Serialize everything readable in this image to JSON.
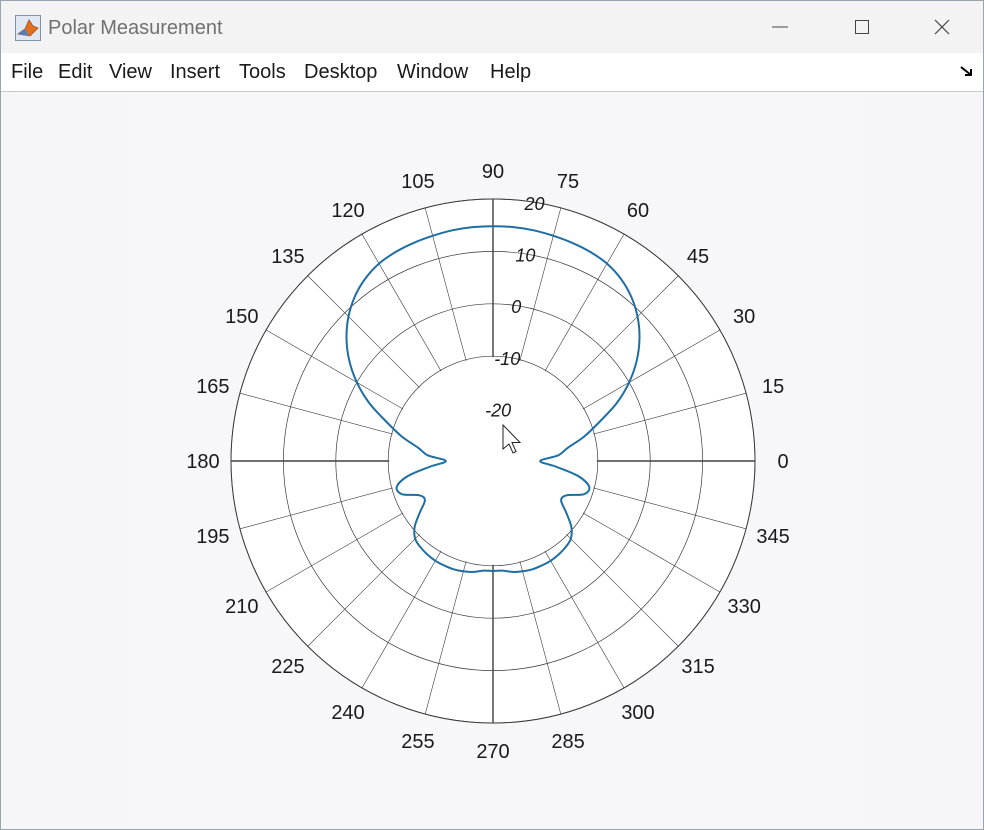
{
  "window": {
    "title": "Polar Measurement",
    "icon": "matlab-figure-icon"
  },
  "menu": [
    {
      "key": "file",
      "label": "File"
    },
    {
      "key": "edit",
      "label": "Edit"
    },
    {
      "key": "view",
      "label": "View"
    },
    {
      "key": "insert",
      "label": "Insert"
    },
    {
      "key": "tools",
      "label": "Tools"
    },
    {
      "key": "desktop",
      "label": "Desktop"
    },
    {
      "key": "window",
      "label": "Window"
    },
    {
      "key": "help",
      "label": "Help"
    }
  ],
  "colors": {
    "trace": "#1f6ea3",
    "grid": "#3a3a3a",
    "axis_bg": "#ffffff",
    "figure_bg": "#f6f6f8"
  },
  "chart_data": {
    "type": "polar",
    "angle_unit": "degrees",
    "angle_ticks": [
      0,
      15,
      30,
      45,
      60,
      75,
      90,
      105,
      120,
      135,
      150,
      165,
      180,
      195,
      210,
      225,
      240,
      255,
      270,
      285,
      300,
      315,
      330,
      345
    ],
    "radial_ticks": [
      -20,
      -10,
      0,
      10,
      20
    ],
    "radial_tick_labels": [
      "-20",
      "-10",
      "0",
      "10",
      "20"
    ],
    "rlim": [
      -30,
      20
    ],
    "grid": true,
    "series": [
      {
        "color": "#1f6ea3",
        "theta_deg": [
          0,
          5,
          10,
          15,
          20,
          25,
          30,
          35,
          40,
          45,
          50,
          55,
          60,
          65,
          70,
          75,
          80,
          85,
          90,
          95,
          100,
          105,
          110,
          115,
          120,
          125,
          130,
          135,
          140,
          145,
          150,
          155,
          160,
          165,
          170,
          175,
          180,
          185,
          190,
          195,
          200,
          205,
          210,
          215,
          220,
          225,
          230,
          235,
          240,
          245,
          250,
          255,
          260,
          265,
          270,
          275,
          280,
          285,
          290,
          295,
          300,
          305,
          310,
          315,
          320,
          325,
          330,
          335,
          340,
          345,
          350,
          355
        ],
        "r": [
          -21,
          -17.5,
          -15.5,
          -12,
          -8.5,
          -4,
          0,
          3.5,
          6.5,
          9,
          11,
          12.5,
          13.5,
          14,
          14.3,
          14.5,
          14.7,
          14.8,
          14.8,
          14.8,
          14.7,
          14.5,
          14.3,
          14,
          13.5,
          12.5,
          11,
          9,
          6.5,
          3.5,
          0,
          -4,
          -8.5,
          -12,
          -15.5,
          -17.5,
          -21,
          -18,
          -13.5,
          -11,
          -11.5,
          -14.5,
          -15,
          -13,
          -10.5,
          -9,
          -8.5,
          -8.2,
          -8,
          -8,
          -8,
          -8.2,
          -8.5,
          -9,
          -9,
          -9,
          -8.5,
          -8.2,
          -8,
          -8,
          -8,
          -8.2,
          -8.5,
          -9,
          -10.5,
          -13,
          -15,
          -14.5,
          -11.5,
          -11,
          -13.5,
          -18
        ]
      }
    ]
  }
}
